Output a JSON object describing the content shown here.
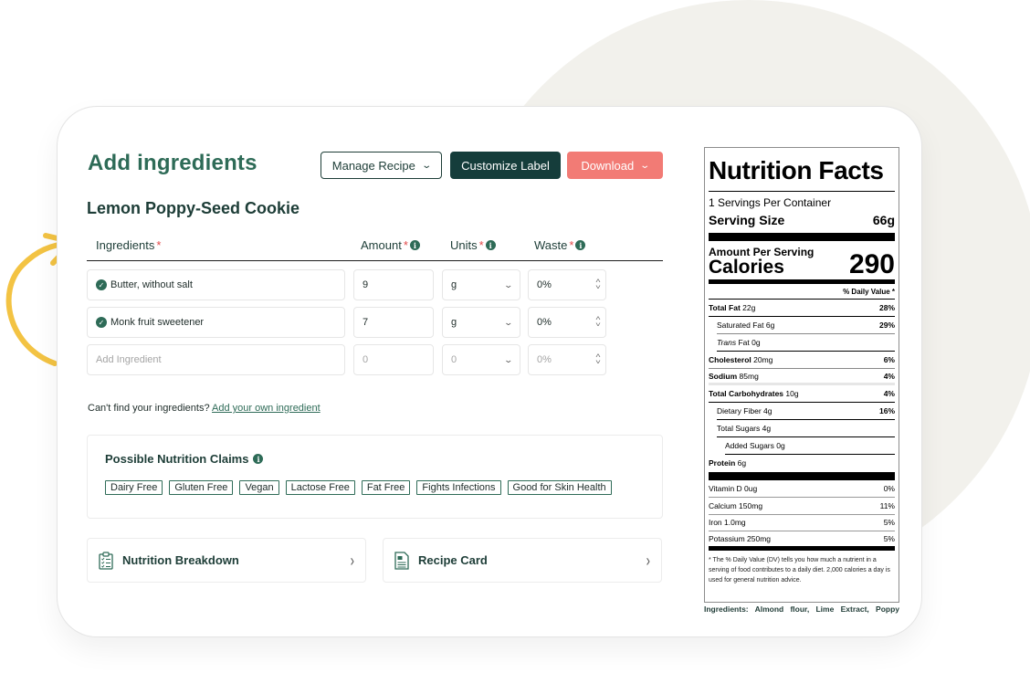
{
  "header": {
    "title": "Add ingredients",
    "recipe_name": "Lemon Poppy-Seed Cookie",
    "buttons": {
      "manage_recipe": "Manage Recipe",
      "customize_label": "Customize Label",
      "download": "Download"
    }
  },
  "colors": {
    "brand_green": "#2e6b57",
    "dark_teal": "#153d3b",
    "download_coral": "#f27b75",
    "accent_yellow": "#f3c343",
    "required_red": "#e24a4a"
  },
  "table": {
    "columns": [
      {
        "label": "Ingredients",
        "required": "*"
      },
      {
        "label": "Amount",
        "required": "*"
      },
      {
        "label": "Units",
        "required": "*"
      },
      {
        "label": "Waste",
        "required": "*"
      }
    ],
    "rows": [
      {
        "ingredient": "Butter, without salt",
        "amount": "9",
        "unit": "g",
        "waste": "0%"
      },
      {
        "ingredient": "Monk fruit sweetener",
        "amount": "7",
        "unit": "g",
        "waste": "0%"
      }
    ],
    "new_row": {
      "placeholder": "Add Ingredient",
      "amount": "0",
      "unit": "0",
      "waste": "0%"
    }
  },
  "help": {
    "text": "Can't find your ingredients?",
    "link": "Add your own ingredient"
  },
  "claims": {
    "title": "Possible Nutrition Claims",
    "items": [
      "Dairy Free",
      "Gluten Free",
      "Vegan",
      "Lactose Free",
      "Fat Free",
      "Fights Infections",
      "Good for Skin Health"
    ]
  },
  "nav_cards": {
    "nutrition_breakdown": "Nutrition Breakdown",
    "recipe_card": "Recipe Card"
  },
  "nutrition_facts": {
    "title": "Nutrition Facts",
    "servings": "1 Servings Per Container",
    "serving_size_label": "Serving Size",
    "serving_size": "66g",
    "amount_per_serving": "Amount Per Serving",
    "calories_label": "Calories",
    "calories": "290",
    "daily_value_header": "% Daily Value *",
    "nutrients": [
      {
        "name": "Total Fat",
        "amount": "22g",
        "dv": "28%"
      },
      {
        "name": "Saturated Fat",
        "amount": "6g",
        "dv": "29%"
      },
      {
        "name": "Trans",
        "amount": "Fat 0g",
        "dv": ""
      },
      {
        "name": "Cholesterol",
        "amount": "20mg",
        "dv": "6%"
      },
      {
        "name": "Sodium",
        "amount": "85mg",
        "dv": "4%"
      },
      {
        "name": "Total Carbohydrates",
        "amount": "10g",
        "dv": "4%"
      },
      {
        "name": "Dietary Fiber",
        "amount": "4g",
        "dv": "16%"
      },
      {
        "name": "Total Sugars",
        "amount": "4g",
        "dv": ""
      },
      {
        "name": "Added Sugars",
        "amount": "0g",
        "dv": ""
      },
      {
        "name": "Protein",
        "amount": "6g",
        "dv": ""
      }
    ],
    "vitamins": [
      {
        "name": "Vitamin D 0ug",
        "dv": "0%"
      },
      {
        "name": "Calcium 150mg",
        "dv": "11%"
      },
      {
        "name": "Iron 1.0mg",
        "dv": "5%"
      },
      {
        "name": "Potassium 250mg",
        "dv": "5%"
      }
    ],
    "footnote": "* The % Daily Value (DV) tells you how much a nutrient in a serving of food contributes to a daily diet. 2,000 calories a day is used for general nutrition advice.",
    "ingredients_line": "Ingredients: Almond flour, Lime Extract, Poppy"
  }
}
